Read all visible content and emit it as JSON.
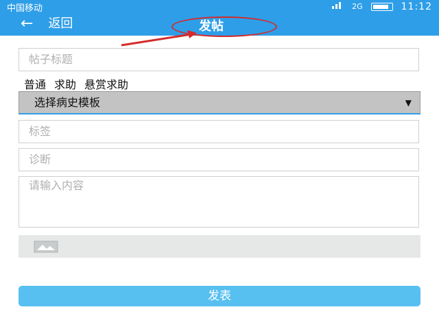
{
  "status_bar": {
    "carrier": "中国移动",
    "network": "2G",
    "time": "11:12"
  },
  "title_bar": {
    "back_label": "返回",
    "title": "发帖"
  },
  "form": {
    "title_placeholder": "帖子标题",
    "post_types": [
      "普通",
      "求助",
      "悬赏求助"
    ],
    "template_select": "选择病史模板",
    "tags_placeholder": "标签",
    "diagnosis_placeholder": "诊断",
    "content_placeholder": "请输入内容",
    "submit_label": "发表"
  },
  "colors": {
    "accent": "#2e9ee8",
    "submit": "#57c0f0",
    "annotation": "#d42a2a"
  }
}
